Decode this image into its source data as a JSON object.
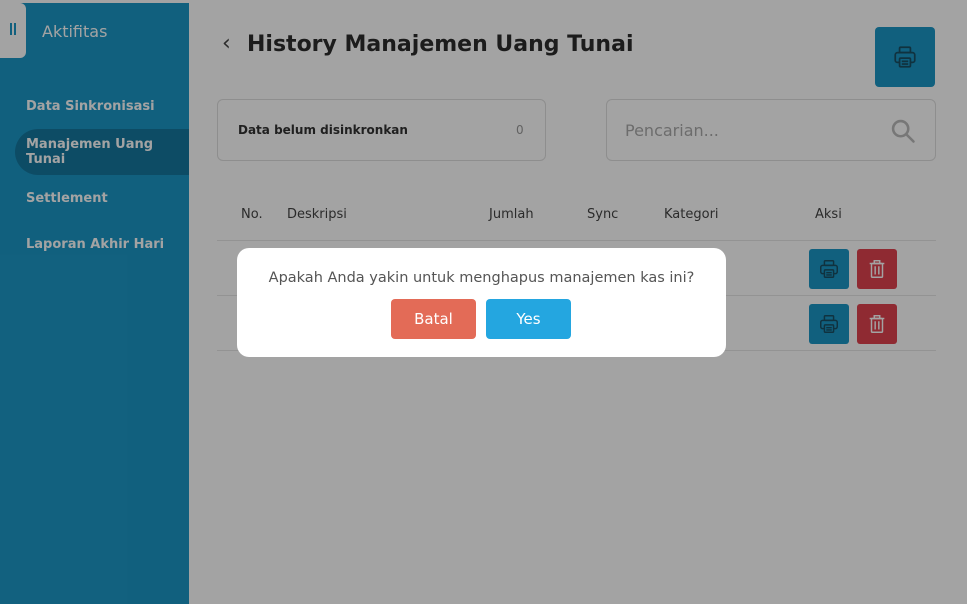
{
  "sidebar": {
    "title": "Aktifitas",
    "items": [
      {
        "label": "Data Sinkronisasi"
      },
      {
        "label": "Manajemen Uang Tunai",
        "active": true
      },
      {
        "label": "Settlement"
      },
      {
        "label": "Laporan Akhir Hari"
      }
    ]
  },
  "header": {
    "title": "History Manajemen Uang Tunai",
    "print_icon": "printer-icon"
  },
  "sync_status": {
    "label": "Data belum disinkronkan",
    "count": "0"
  },
  "search": {
    "placeholder": "Pencarian...",
    "icon": "search-icon"
  },
  "table": {
    "columns": [
      "No.",
      "Deskripsi",
      "Jumlah",
      "Sync",
      "Kategori",
      "Aksi"
    ],
    "row_count": 2
  },
  "dialog": {
    "message": "Apakah Anda yakin untuk menghapus manajemen kas ini?",
    "cancel_label": "Batal",
    "confirm_label": "Yes"
  },
  "colors": {
    "primary": "#1c97c6",
    "danger": "#e0424f",
    "cancel": "#e36b57",
    "confirm": "#24a6e0"
  }
}
